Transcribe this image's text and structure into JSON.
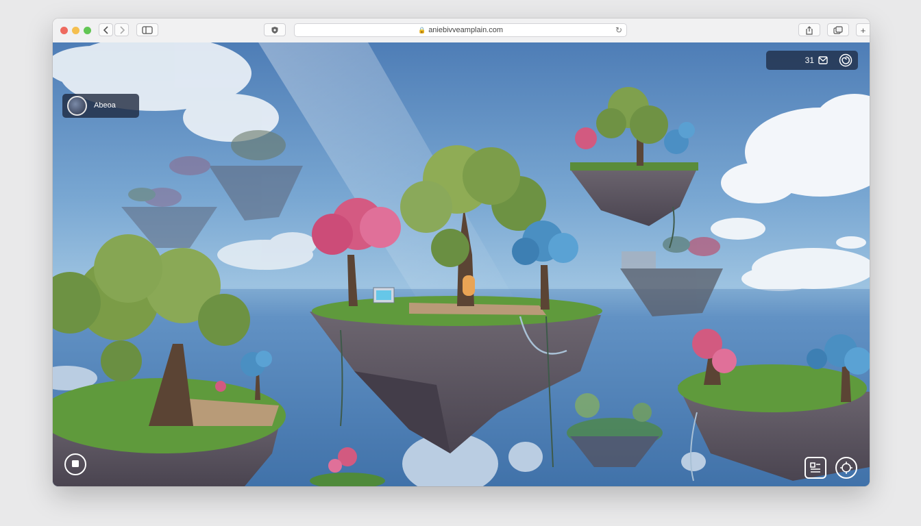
{
  "browser": {
    "url": "aniebivveamplain.com",
    "back_icon": "chevron-left-icon",
    "forward_icon": "chevron-right-icon",
    "sidebar_icon": "sidebar-icon",
    "privacy_icon": "shield-icon",
    "reload_icon": "reload-icon",
    "share_icon": "share-icon",
    "tabs_icon": "tabs-icon",
    "new_tab_label": "+"
  },
  "hud": {
    "count": "31",
    "mail_icon": "mail-icon",
    "swirl_icon": "swirl-icon",
    "player_name": "Abeoa",
    "avatar_icon": "avatar-icon",
    "bottom_left_icon": "stop-icon",
    "bottom_right_icons": [
      "menu-icon",
      "compass-icon"
    ]
  },
  "colors": {
    "sky_top": "#4f7fb8",
    "sea": "#3f6ea6",
    "grass": "#5f9a3c",
    "rock": "#5d5760",
    "tree_green": "#7a9a45",
    "tree_pink": "#d9567e",
    "tree_blue": "#4a8fc2"
  }
}
